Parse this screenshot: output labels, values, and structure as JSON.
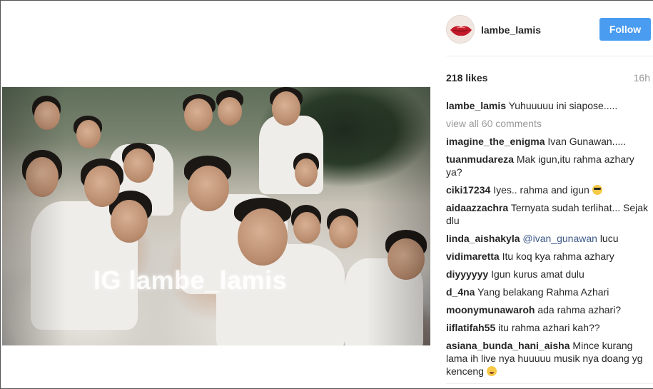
{
  "post": {
    "watermark": "IG lambe_lamis"
  },
  "header": {
    "username": "lambe_lamis",
    "follow_label": "Follow",
    "avatar_icon": "lips-icon"
  },
  "stats": {
    "likes": "218 likes",
    "time": "16h"
  },
  "caption": {
    "user": "lambe_lamis",
    "text": "Yuhuuuuu ini siapose....."
  },
  "view_all": "view all 60 comments",
  "comments": [
    {
      "user": "imagine_the_enigma",
      "text": "Ivan Gunawan....."
    },
    {
      "user": "tuanmudareza",
      "text": "Mak igun,itu rahma azhary ya?"
    },
    {
      "user": "ciki17234",
      "text": "Iyes.. rahma and igun",
      "emoji": "cool"
    },
    {
      "user": "aidaazzachra",
      "text": "Ternyata sudah terlihat... Sejak dlu"
    },
    {
      "user": "linda_aishakyla",
      "mention": "@ivan_gunawan",
      "text": "lucu"
    },
    {
      "user": "vidimaretta",
      "text": "Itu koq kya rahma azhary"
    },
    {
      "user": "diyyyyyy",
      "text": "Igun kurus amat dulu"
    },
    {
      "user": "d_4na",
      "text": "Yang belakang Rahma Azhari"
    },
    {
      "user": "moonymunawaroh",
      "text": "ada rahma azhari?"
    },
    {
      "user": "iiflatifah55",
      "text": "itu rahma azhari kah??"
    },
    {
      "user": "asiana_bunda_hani_aisha",
      "text": "Mince kurang lama ih live nya huuuuu musik nya doang yg kenceng",
      "emoji": "laugh"
    }
  ],
  "colors": {
    "follow_button": "#4a9cf0",
    "mention": "#3e5a8a",
    "muted": "#999999"
  }
}
